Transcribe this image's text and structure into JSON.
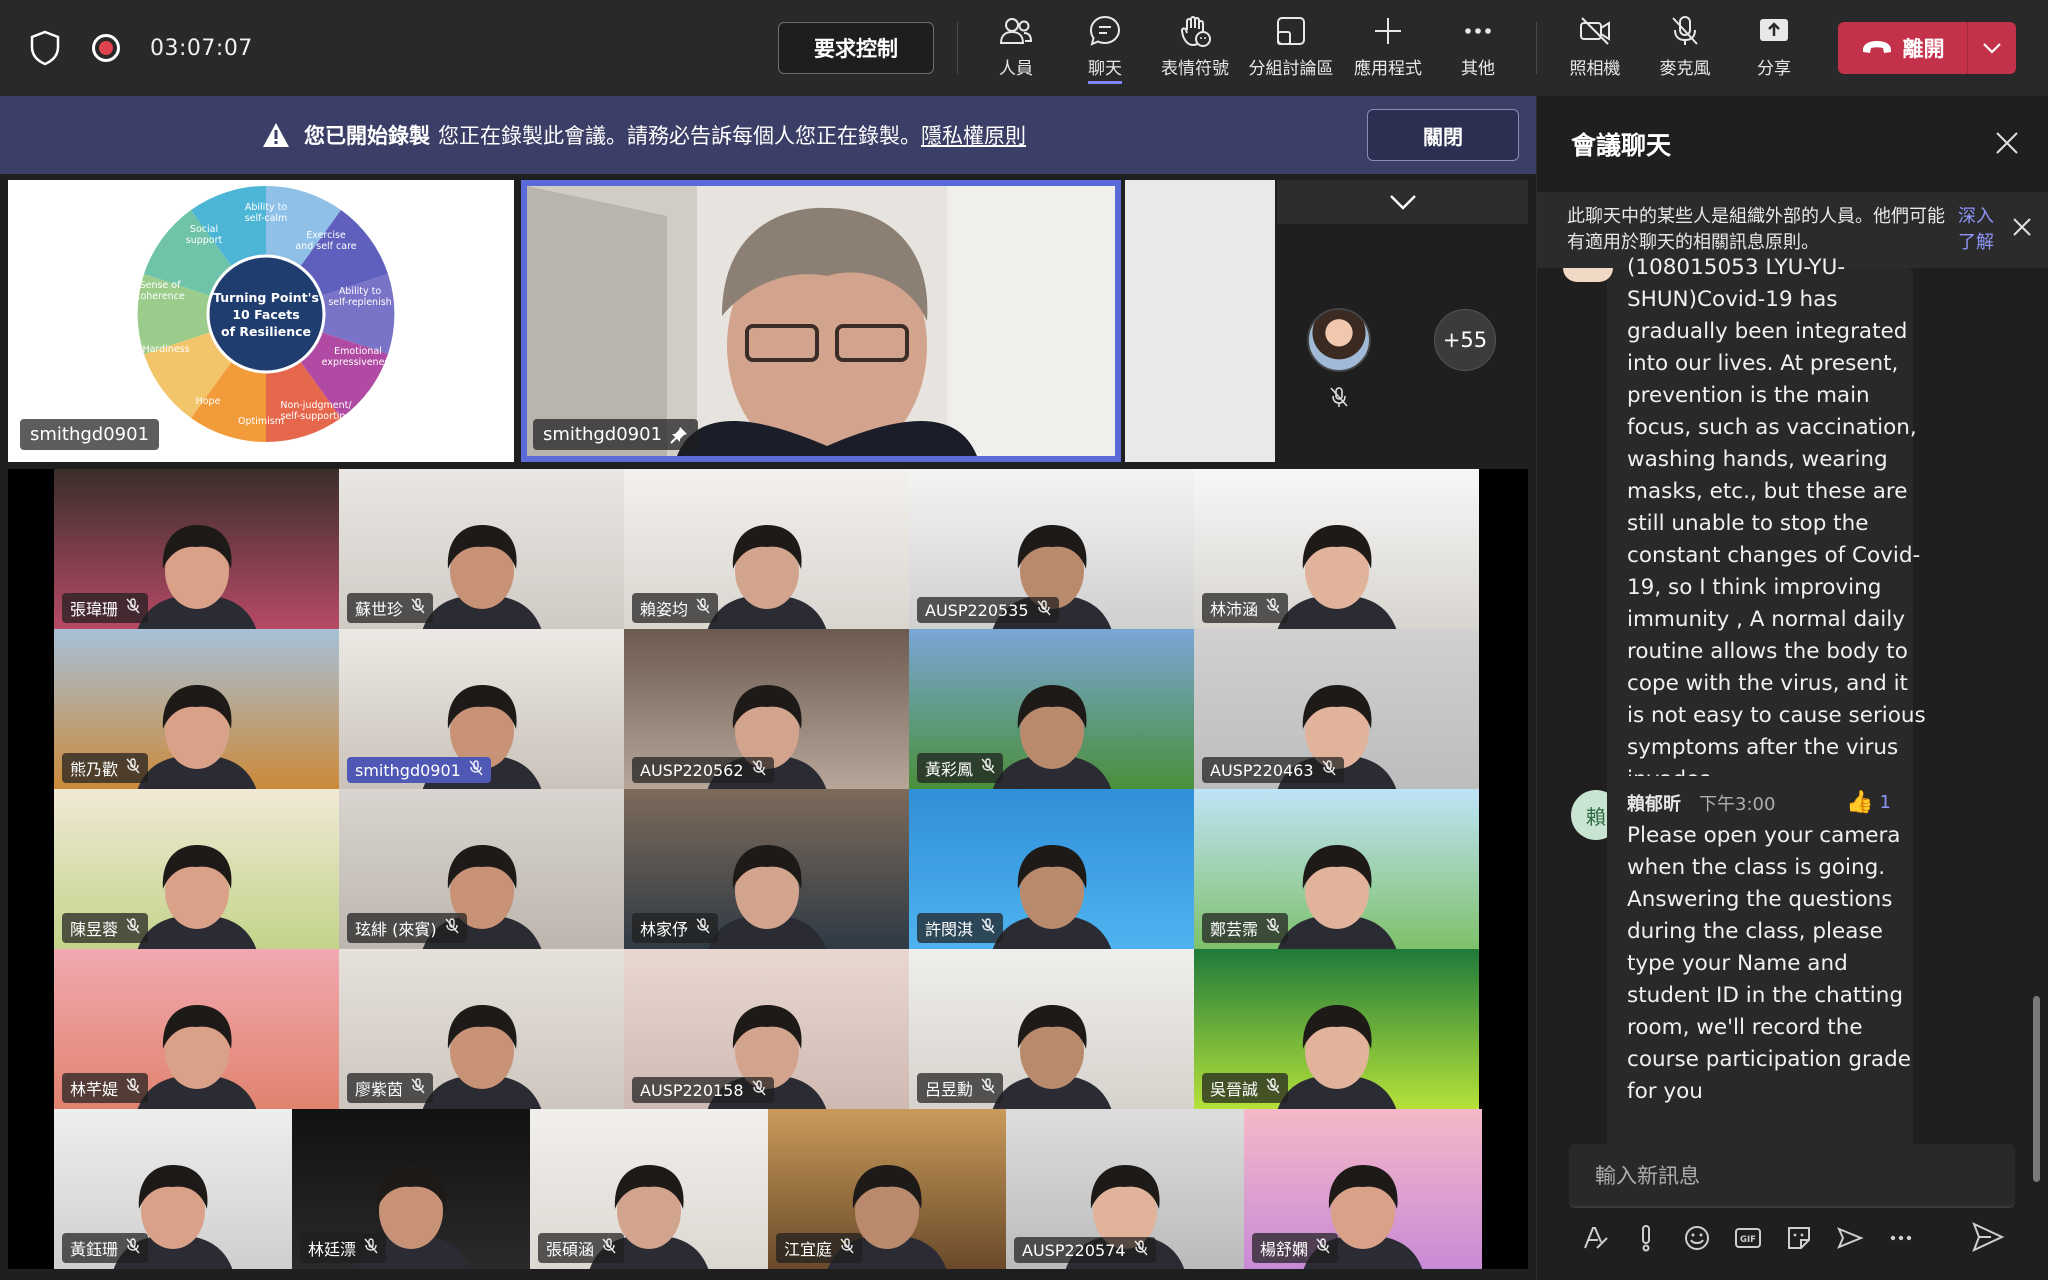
{
  "topbar": {
    "timer": "03:07:07",
    "request_control": "要求控制",
    "tools": [
      {
        "label": "人員",
        "icon": "people-icon"
      },
      {
        "label": "聊天",
        "icon": "chat-icon"
      },
      {
        "label": "表情符號",
        "icon": "reactions-icon"
      },
      {
        "label": "分組討論區",
        "icon": "breakout-rooms-icon"
      },
      {
        "label": "應用程式",
        "icon": "add-apps-icon"
      },
      {
        "label": "其他",
        "icon": "more-icon"
      }
    ],
    "devices": [
      {
        "label": "照相機",
        "icon": "camera-off-icon"
      },
      {
        "label": "麥克風",
        "icon": "mic-off-icon"
      },
      {
        "label": "分享",
        "icon": "share-icon"
      }
    ],
    "leave": "離開"
  },
  "banner": {
    "title": "您已開始錄製",
    "text": "您正在錄製此會議。請務必告訴每個人您正在錄製。",
    "link": "隱私權原則",
    "close": "關閉"
  },
  "stage": {
    "share_label": "smithgd0901",
    "speaker_label": "smithgd0901",
    "overflow_count": "+55",
    "wheel": {
      "center": "Turning Point's 10 Facets of Resilience",
      "facets": [
        "Ability to self-calm",
        "Exercise and self care",
        "Ability to self-replenish",
        "Emotional expressiveness",
        "Non-judgment/ self-supporting",
        "Optimism",
        "Hope",
        "Hardiness",
        "Sense of coherence",
        "Social support"
      ]
    }
  },
  "gallery": [
    "張瑋珊",
    "蘇世珍",
    "賴姿均",
    "AUSP220535",
    "林沛涵",
    "熊乃歡",
    "smithgd0901",
    "AUSP220562",
    "黃彩鳳",
    "AUSP220463",
    "陳昱蓉",
    "玹緋 (來賓)",
    "林家伃",
    "許閔淇",
    "鄭芸霈",
    "林芊媞",
    "廖紫茵",
    "AUSP220158",
    "呂昱勳",
    "吳晉誠",
    "黃鈺珊",
    "林廷漂",
    "張碩涵",
    "江宜庭",
    "AUSP220574",
    "楊舒嫻"
  ],
  "chat": {
    "title": "會議聊天",
    "notice": "此聊天中的某些人是組織外部的人員。他們可能有適用於聊天的相關訊息原則。",
    "notice_link": "深入了解",
    "messages": [
      {
        "text": "(108015053 LYU-YU-SHUN)Covid-19 has gradually been integrated into our lives. At present, prevention is the main focus, such as vaccination, washing hands, wearing masks, etc., but these are still unable to stop the constant changes of Covid-19, so I think improving immunity , A normal daily routine allows the body to cope with the virus, and it is not easy to cause serious symptoms after the virus invades."
      },
      {
        "avatar": "賴",
        "sender": "賴郁昕",
        "time": "下午3:00",
        "reaction_count": "1",
        "text": "Please open your camera when the class is going. Answering the questions during the class, please type your Name and student ID in the chatting room, we'll record the course participation grade for you"
      }
    ],
    "composer_placeholder": "輸入新訊息"
  },
  "colors": {
    "accent": "#7f85f5",
    "leave": "#c4314b",
    "banner": "#3b3e66"
  }
}
